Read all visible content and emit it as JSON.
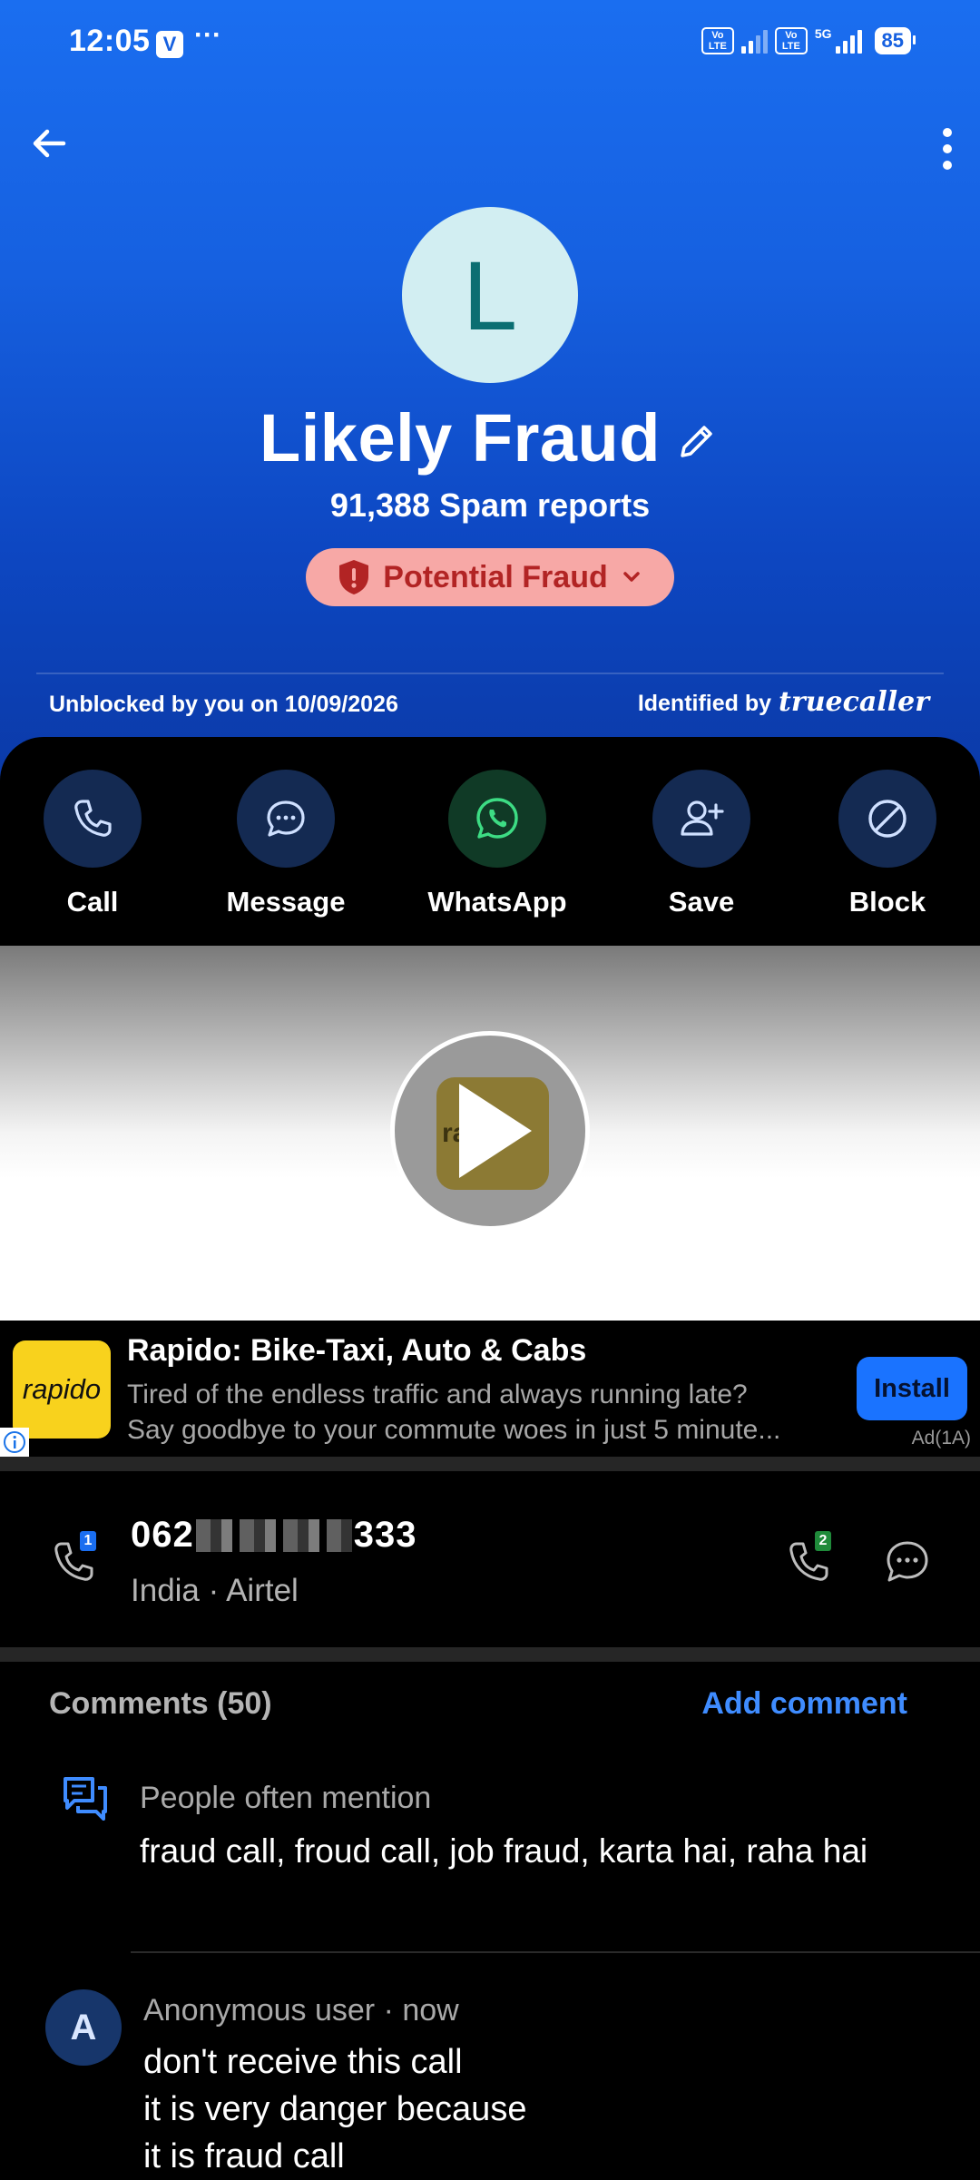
{
  "status_bar": {
    "time": "12:05",
    "badge": "V",
    "more": "···",
    "volte1": "Vo LTE",
    "volte2": "Vo LTE",
    "network": "5G",
    "battery": "85"
  },
  "contact": {
    "avatar_letter": "L",
    "name": "Likely Fraud",
    "spam_reports": "91,388 Spam reports",
    "fraud_label": "Potential Fraud",
    "unblocked": "Unblocked by you on 10/09/2026",
    "identified_by": "Identified by",
    "brand": "truecaller"
  },
  "actions": [
    {
      "label": "Call",
      "icon": "phone-icon"
    },
    {
      "label": "Message",
      "icon": "chat-bubble-icon"
    },
    {
      "label": "WhatsApp",
      "icon": "whatsapp-icon"
    },
    {
      "label": "Save",
      "icon": "add-person-icon"
    },
    {
      "label": "Block",
      "icon": "block-icon"
    }
  ],
  "ad": {
    "logo_text": "rapido",
    "video_logo_text": "ra",
    "title": "Rapido: Bike-Taxi, Auto & Cabs",
    "desc_line1": "Tired of the endless traffic and always running late?",
    "desc_line2": "Say goodbye to your commute woes in just 5 minute...",
    "install": "Install",
    "tag": "Ad(1A)"
  },
  "number": {
    "prefix": "062",
    "suffix": "333",
    "carrier": "India · Airtel",
    "sim1": "1",
    "sim2": "2"
  },
  "comments": {
    "title": "Comments (50)",
    "add": "Add comment",
    "mention_label": "People often mention",
    "mention_text": "fraud call, froud call, job fraud, karta hai, raha hai",
    "items": [
      {
        "avatar": "A",
        "meta": "Anonymous user · now",
        "line1": "don't receive this call",
        "line2": "it is very danger because",
        "line3": "it is fraud call"
      }
    ]
  },
  "colors": {
    "header_blue": "#1660e0",
    "fraud_pill": "#f7a8a6",
    "accent_blue": "#3f8cff",
    "ad_yellow": "#f8d21d"
  }
}
